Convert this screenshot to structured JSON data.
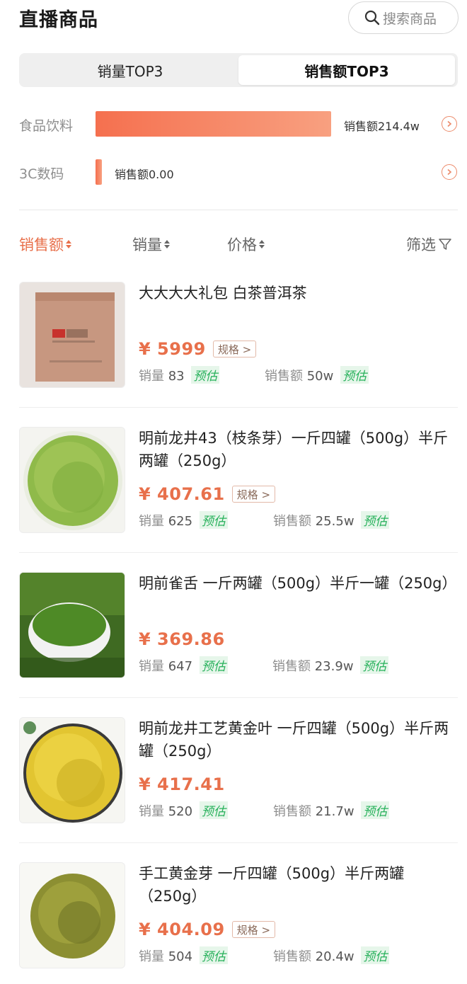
{
  "header": {
    "title": "直播商品",
    "search_label": "搜索商品",
    "search_icon": "search-icon"
  },
  "tabs": [
    {
      "label": "销量TOP3",
      "active": false
    },
    {
      "label": "销售额TOP3",
      "active": true
    }
  ],
  "categories": [
    {
      "label": "食品饮料",
      "value": "销售额214.4w",
      "fill": 1.0
    },
    {
      "label": "3C数码",
      "value": "销售额0.00",
      "fill": 0.0
    }
  ],
  "sort": {
    "sales_amount": "销售额",
    "sales_volume": "销量",
    "price": "价格",
    "filter": "筛选"
  },
  "estimate_label": "预估",
  "stat_labels": {
    "volume": "销量",
    "amount": "销售额"
  },
  "colors": {
    "accent": "#e8704b",
    "bar_start": "#f5704f",
    "bar_end": "#f8a080",
    "estimate": "#27b15b"
  },
  "products": [
    {
      "name": "大大大大礼包 白茶普洱茶",
      "price": "¥ 5999",
      "spec": "规格 >",
      "volume": "83",
      "amount": "50w"
    },
    {
      "name": "明前龙井43（枝条芽）一斤四罐（500g）半斤两罐（250g）",
      "price": "¥ 407.61",
      "spec": "规格 >",
      "volume": "625",
      "amount": "25.5w"
    },
    {
      "name": "明前雀舌 一斤两罐（500g）半斤一罐（250g）",
      "price": "¥ 369.86",
      "spec": "",
      "volume": "647",
      "amount": "23.9w"
    },
    {
      "name": "明前龙井工艺黄金叶 一斤四罐（500g）半斤两罐（250g）",
      "price": "¥ 417.41",
      "spec": "",
      "volume": "520",
      "amount": "21.7w"
    },
    {
      "name": "手工黄金芽 一斤四罐（500g）半斤两罐（250g）",
      "price": "¥ 404.09",
      "spec": "规格 >",
      "volume": "504",
      "amount": "20.4w"
    }
  ]
}
